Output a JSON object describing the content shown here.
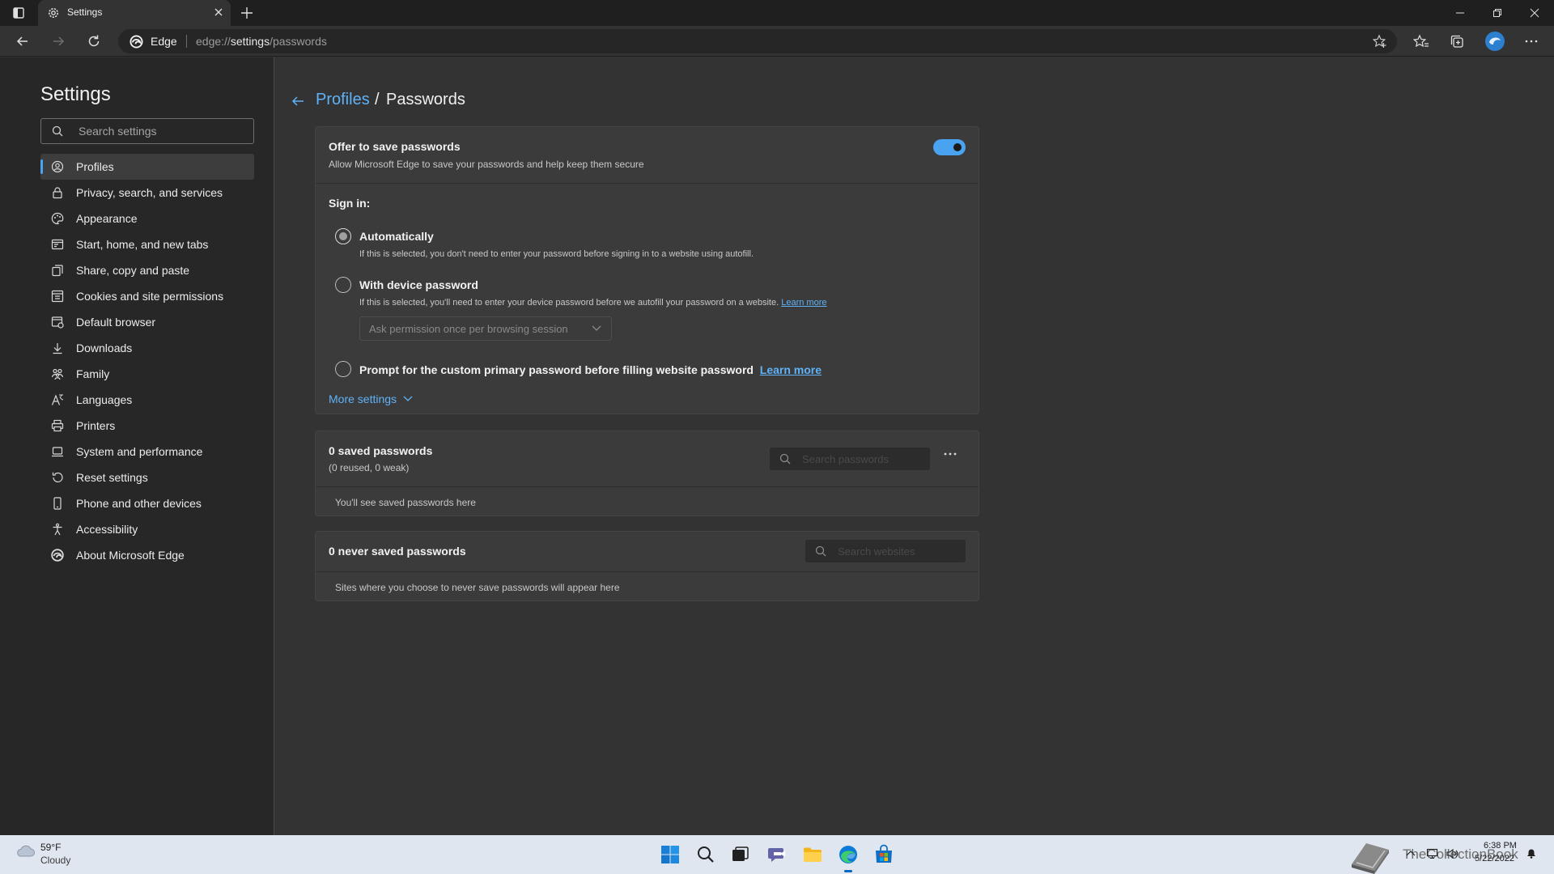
{
  "tab": {
    "title": "Settings"
  },
  "address": {
    "brand": "Edge",
    "url_prefix": "edge://",
    "url_host": "settings",
    "url_path": "/passwords"
  },
  "sidebar": {
    "title": "Settings",
    "search_placeholder": "Search settings",
    "items": [
      {
        "label": "Profiles",
        "icon": "profile-icon",
        "active": true
      },
      {
        "label": "Privacy, search, and services",
        "icon": "lock-icon"
      },
      {
        "label": "Appearance",
        "icon": "appearance-icon"
      },
      {
        "label": "Start, home, and new tabs",
        "icon": "start-page-icon"
      },
      {
        "label": "Share, copy and paste",
        "icon": "share-icon"
      },
      {
        "label": "Cookies and site permissions",
        "icon": "cookies-icon"
      },
      {
        "label": "Default browser",
        "icon": "default-browser-icon"
      },
      {
        "label": "Downloads",
        "icon": "download-icon"
      },
      {
        "label": "Family",
        "icon": "family-icon"
      },
      {
        "label": "Languages",
        "icon": "language-icon"
      },
      {
        "label": "Printers",
        "icon": "printer-icon"
      },
      {
        "label": "System and performance",
        "icon": "laptop-icon"
      },
      {
        "label": "Reset settings",
        "icon": "reset-icon"
      },
      {
        "label": "Phone and other devices",
        "icon": "phone-icon"
      },
      {
        "label": "Accessibility",
        "icon": "accessibility-icon"
      },
      {
        "label": "About Microsoft Edge",
        "icon": "edge-logo-icon"
      }
    ]
  },
  "breadcrumb": {
    "parent": "Profiles",
    "separator": "/",
    "current": "Passwords"
  },
  "offer": {
    "title": "Offer to save passwords",
    "description": "Allow Microsoft Edge to save your passwords and help keep them secure",
    "enabled": true
  },
  "signin": {
    "label": "Sign in:",
    "auto_title": "Automatically",
    "auto_desc": "If this is selected, you don't need to enter your password before signing in to a website using autofill.",
    "device_title": "With device password",
    "device_desc": "If this is selected, you'll need to enter your device password before we autofill your password on a website.",
    "device_link": "Learn more",
    "device_dropdown": "Ask permission once per browsing session",
    "custom_title": "Prompt for the custom primary password before filling website password",
    "custom_link": "Learn more",
    "selected": "Automatically",
    "more_settings": "More settings"
  },
  "saved": {
    "title": "0 saved passwords",
    "subtitle": "(0 reused, 0 weak)",
    "search_placeholder": "Search passwords",
    "empty": "You'll see saved passwords here"
  },
  "never_saved": {
    "title": "0 never saved passwords",
    "search_placeholder": "Search websites",
    "empty": "Sites where you choose to never save passwords will appear here"
  },
  "taskbar": {
    "temperature": "59°F",
    "condition": "Cloudy",
    "watermark": "TheCollectionBook",
    "time": "6:38 PM",
    "date": "5/22/2022"
  },
  "colors": {
    "accent": "#4aa3f0",
    "link": "#5fb2f7",
    "background": "#333333",
    "sidebar": "#272727",
    "card": "#3b3b3b"
  }
}
